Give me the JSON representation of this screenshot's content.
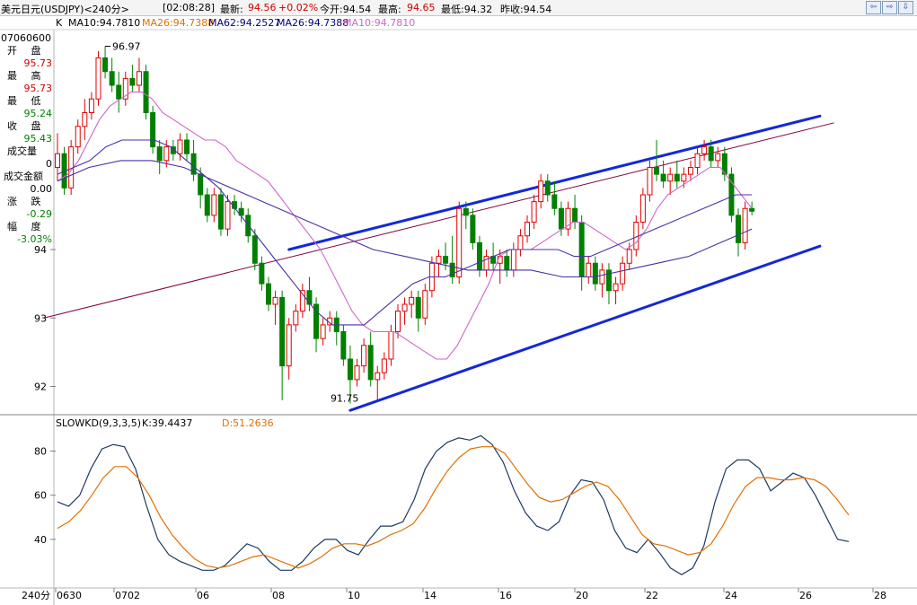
{
  "header": {
    "title": "美元日元(USDJPY)<240分>",
    "time": "[02:08:28]",
    "latest_label": "最新:",
    "latest_value": "94.56",
    "change": "+0.02%",
    "open": "今开:94.54",
    "high_label": "最高:",
    "high_value": "94.65",
    "low": "最低:94.32",
    "prev_close": "昨收:94.54",
    "nav": [
      "⇦",
      "⇨",
      "⇩"
    ]
  },
  "ma_legend": {
    "k": "K",
    "ma10": "MA10:94.7810",
    "ma26a": "MA26:94.7388",
    "ma62": "MA62:94.2527",
    "ma26b": "MA26:94.7388",
    "ma10b": "MA10:94.7810",
    "colors": {
      "ma10": "#000080",
      "ma26": "#e07000",
      "ma62": "#000080",
      "ma26b": "#000080",
      "ma10b": "#cc66cc"
    }
  },
  "info_panel": {
    "date": "07060600",
    "open_label": "开 盘",
    "open_value": "95.73",
    "high_label": "最 高",
    "high_value": "95.73",
    "low_label": "最 低",
    "low_value": "95.24",
    "close_label": "收 盘",
    "close_value": "95.43",
    "volume_label": "成交量",
    "volume_value": "0",
    "amount_label": "成交金额",
    "amount_value": "0.00",
    "change_label": "涨 跌",
    "change_value": "-0.29",
    "pct_label": "幅 度",
    "pct_value": "-3.03%"
  },
  "indicator_legend": {
    "name": "SLOWKD(9,3,3,5)",
    "k": "K:39.4437",
    "d": "D:51.2636"
  },
  "period_label": "240分",
  "chart_data": [
    {
      "type": "candlestick",
      "title": "美元日元(USDJPY)<240分>",
      "ylim": [
        91.6,
        97.2
      ],
      "yticks": [
        92,
        93,
        94
      ],
      "price_annotations": [
        {
          "text": "96.97",
          "value": 96.97
        },
        {
          "text": "91.75",
          "value": 91.75
        }
      ],
      "x_labels": [
        "0630",
        "0702",
        "06",
        "08",
        "10",
        "14",
        "16",
        "20",
        "22",
        "24",
        "26",
        "28"
      ],
      "candles": [
        [
          95.2,
          95.7,
          95.0,
          95.4
        ],
        [
          95.4,
          95.5,
          94.8,
          94.9
        ],
        [
          94.9,
          95.6,
          94.8,
          95.5
        ],
        [
          95.5,
          95.9,
          95.4,
          95.8
        ],
        [
          95.8,
          96.2,
          95.6,
          96.0
        ],
        [
          96.0,
          96.3,
          95.9,
          96.2
        ],
        [
          96.2,
          96.9,
          96.1,
          96.8
        ],
        [
          96.8,
          96.97,
          96.5,
          96.6
        ],
        [
          96.6,
          96.8,
          96.3,
          96.4
        ],
        [
          96.4,
          96.6,
          96.0,
          96.2
        ],
        [
          96.2,
          96.6,
          96.1,
          96.5
        ],
        [
          96.5,
          96.7,
          96.3,
          96.4
        ],
        [
          96.4,
          96.8,
          96.3,
          96.6
        ],
        [
          96.6,
          96.7,
          95.9,
          96.0
        ],
        [
          96.0,
          96.1,
          95.4,
          95.5
        ],
        [
          95.5,
          95.6,
          95.1,
          95.3
        ],
        [
          95.3,
          95.6,
          95.2,
          95.5
        ],
        [
          95.5,
          95.6,
          95.3,
          95.4
        ],
        [
          95.4,
          95.7,
          95.3,
          95.6
        ],
        [
          95.6,
          95.7,
          95.3,
          95.4
        ],
        [
          95.4,
          95.6,
          95.0,
          95.1
        ],
        [
          95.1,
          95.2,
          94.6,
          94.8
        ],
        [
          94.8,
          94.9,
          94.4,
          94.5
        ],
        [
          94.5,
          94.9,
          94.4,
          94.8
        ],
        [
          94.8,
          94.9,
          94.2,
          94.3
        ],
        [
          94.3,
          94.8,
          94.2,
          94.7
        ],
        [
          94.7,
          94.8,
          94.5,
          94.6
        ],
        [
          94.6,
          94.7,
          94.4,
          94.5
        ],
        [
          94.5,
          94.6,
          94.1,
          94.2
        ],
        [
          94.2,
          94.3,
          93.7,
          93.8
        ],
        [
          93.8,
          93.9,
          93.4,
          93.5
        ],
        [
          93.5,
          93.6,
          93.1,
          93.2
        ],
        [
          93.2,
          93.4,
          92.9,
          93.3
        ],
        [
          93.3,
          93.4,
          91.8,
          92.3
        ],
        [
          92.3,
          93.0,
          92.1,
          92.9
        ],
        [
          92.9,
          93.2,
          92.8,
          93.1
        ],
        [
          93.1,
          93.5,
          93.0,
          93.4
        ],
        [
          93.4,
          93.6,
          93.1,
          93.2
        ],
        [
          93.2,
          93.3,
          92.5,
          92.7
        ],
        [
          92.7,
          93.0,
          92.6,
          92.9
        ],
        [
          92.9,
          93.1,
          92.8,
          93.0
        ],
        [
          93.0,
          93.1,
          92.6,
          92.8
        ],
        [
          92.8,
          92.9,
          92.3,
          92.4
        ],
        [
          92.4,
          92.6,
          91.75,
          92.1
        ],
        [
          92.1,
          92.4,
          92.0,
          92.3
        ],
        [
          92.3,
          92.7,
          92.2,
          92.6
        ],
        [
          92.6,
          92.8,
          92.0,
          92.1
        ],
        [
          92.1,
          92.3,
          91.8,
          92.2
        ],
        [
          92.2,
          92.5,
          92.1,
          92.4
        ],
        [
          92.4,
          92.9,
          92.3,
          92.8
        ],
        [
          92.8,
          93.2,
          92.7,
          93.1
        ],
        [
          93.1,
          93.3,
          92.9,
          93.2
        ],
        [
          93.2,
          93.4,
          93.0,
          93.3
        ],
        [
          93.3,
          93.4,
          92.8,
          93.0
        ],
        [
          93.0,
          93.5,
          92.9,
          93.4
        ],
        [
          93.4,
          93.9,
          93.3,
          93.8
        ],
        [
          93.8,
          94.0,
          93.6,
          93.9
        ],
        [
          93.9,
          94.1,
          93.7,
          93.8
        ],
        [
          93.8,
          94.2,
          93.5,
          93.6
        ],
        [
          93.6,
          94.7,
          93.5,
          94.6
        ],
        [
          94.6,
          94.7,
          94.3,
          94.5
        ],
        [
          94.5,
          94.6,
          94.0,
          94.1
        ],
        [
          94.1,
          94.2,
          93.6,
          93.7
        ],
        [
          93.7,
          94.0,
          93.6,
          93.9
        ],
        [
          93.9,
          94.1,
          93.7,
          93.8
        ],
        [
          93.8,
          94.0,
          93.5,
          93.9
        ],
        [
          93.9,
          94.0,
          93.6,
          93.7
        ],
        [
          93.7,
          94.1,
          93.6,
          94.0
        ],
        [
          94.0,
          94.3,
          93.9,
          94.2
        ],
        [
          94.2,
          94.5,
          94.1,
          94.4
        ],
        [
          94.4,
          94.8,
          94.3,
          94.7
        ],
        [
          94.7,
          95.1,
          94.6,
          95.0
        ],
        [
          95.0,
          95.1,
          94.7,
          94.8
        ],
        [
          94.8,
          95.0,
          94.5,
          94.6
        ],
        [
          94.6,
          94.7,
          94.2,
          94.3
        ],
        [
          94.3,
          94.7,
          94.2,
          94.6
        ],
        [
          94.6,
          94.8,
          94.3,
          94.4
        ],
        [
          94.4,
          94.5,
          93.4,
          93.6
        ],
        [
          93.6,
          93.9,
          93.5,
          93.8
        ],
        [
          93.8,
          93.9,
          93.4,
          93.5
        ],
        [
          93.5,
          93.8,
          93.3,
          93.7
        ],
        [
          93.7,
          93.8,
          93.2,
          93.4
        ],
        [
          93.4,
          93.6,
          93.2,
          93.5
        ],
        [
          93.5,
          93.9,
          93.4,
          93.8
        ],
        [
          93.8,
          94.1,
          93.7,
          94.0
        ],
        [
          94.0,
          94.5,
          93.9,
          94.4
        ],
        [
          94.4,
          94.9,
          94.3,
          94.8
        ],
        [
          94.8,
          95.3,
          94.7,
          95.2
        ],
        [
          95.2,
          95.6,
          95.0,
          95.1
        ],
        [
          95.1,
          95.3,
          94.9,
          95.0
        ],
        [
          95.0,
          95.2,
          94.8,
          95.1
        ],
        [
          95.1,
          95.3,
          94.9,
          95.0
        ],
        [
          95.0,
          95.2,
          94.9,
          95.1
        ],
        [
          95.1,
          95.3,
          95.0,
          95.2
        ],
        [
          95.2,
          95.5,
          95.1,
          95.4
        ],
        [
          95.4,
          95.6,
          95.3,
          95.5
        ],
        [
          95.5,
          95.6,
          95.2,
          95.3
        ],
        [
          95.3,
          95.5,
          95.2,
          95.4
        ],
        [
          95.4,
          95.5,
          95.0,
          95.1
        ],
        [
          95.1,
          95.2,
          94.4,
          94.5
        ],
        [
          94.5,
          94.6,
          93.9,
          94.1
        ],
        [
          94.1,
          94.7,
          94.0,
          94.6
        ],
        [
          94.6,
          94.7,
          94.5,
          94.56
        ]
      ],
      "lines": [
        {
          "name": "MA10",
          "color": "#cc66cc",
          "values": [
            95.0,
            95.1,
            95.3,
            95.6,
            95.9,
            96.1,
            96.2,
            96.3,
            96.3,
            96.2,
            96.0,
            95.9,
            95.8,
            95.7,
            95.6,
            95.6,
            95.5,
            95.3,
            95.2,
            95.1,
            95.0,
            94.8,
            94.6,
            94.4,
            94.2,
            94.0,
            93.7,
            93.4,
            93.1,
            92.9,
            92.8,
            92.8,
            92.8,
            92.7,
            92.6,
            92.5,
            92.4,
            92.4,
            92.6,
            92.9,
            93.2,
            93.5,
            93.9,
            94.0,
            94.0,
            94.0,
            94.1,
            94.2,
            94.3,
            94.4,
            94.4,
            94.3,
            94.2,
            94.1,
            94.0,
            94.1,
            94.3,
            94.6,
            94.8,
            94.9,
            95.0,
            95.1,
            95.2,
            95.2,
            95.0,
            94.8,
            94.6
          ]
        },
        {
          "name": "MA26",
          "color": "#4b2fa8",
          "values": [
            95.1,
            95.2,
            95.3,
            95.5,
            95.6,
            95.6,
            95.6,
            95.5,
            95.3,
            95.1,
            94.9,
            94.6,
            94.3,
            94.0,
            93.7,
            93.4,
            93.1,
            92.9,
            92.9,
            92.9,
            93.1,
            93.3,
            93.5,
            93.6,
            93.6,
            93.7,
            93.8,
            93.9,
            94.0,
            94.0,
            94.0,
            94.0,
            93.9,
            93.9,
            94.0,
            94.1,
            94.2,
            94.3,
            94.4,
            94.5,
            94.6,
            94.7,
            94.8,
            94.8
          ]
        },
        {
          "name": "MA62",
          "color": "#4b2fa8",
          "values": [
            95.0,
            95.2,
            95.3,
            95.3,
            95.2,
            95.0,
            94.8,
            94.6,
            94.4,
            94.2,
            94.0,
            93.9,
            93.8,
            93.7,
            93.7,
            93.7,
            93.6,
            93.6,
            93.7,
            93.8,
            93.9,
            94.1,
            94.3
          ]
        }
      ],
      "trendlines": [
        {
          "name": "channel-upper",
          "color": "#1428d8",
          "from": [
            34,
            94.0
          ],
          "to": [
            112,
            95.95
          ]
        },
        {
          "name": "channel-lower",
          "color": "#1428d8",
          "from": [
            43,
            91.65
          ],
          "to": [
            112,
            94.05
          ]
        },
        {
          "name": "long-trend",
          "color": "#800040",
          "from": [
            -2,
            93.0
          ],
          "to": [
            114,
            95.85
          ]
        }
      ]
    },
    {
      "type": "line",
      "title": "SLOWKD(9,3,3,5)",
      "ylim": [
        20,
        90
      ],
      "yticks": [
        40,
        60,
        80
      ],
      "series": [
        {
          "name": "K",
          "color": "#1e3a5f",
          "values": [
            57,
            55,
            60,
            72,
            81,
            83,
            82,
            72,
            55,
            40,
            33,
            30,
            28,
            26,
            26,
            28,
            33,
            38,
            36,
            30,
            26,
            26,
            30,
            36,
            40,
            40,
            35,
            33,
            40,
            46,
            46,
            48,
            58,
            72,
            80,
            84,
            86,
            85,
            87,
            83,
            75,
            62,
            52,
            46,
            44,
            48,
            60,
            67,
            66,
            58,
            44,
            36,
            34,
            40,
            34,
            27,
            24,
            27,
            37,
            57,
            72,
            76,
            76,
            72,
            62,
            66,
            70,
            68,
            60,
            50,
            40,
            39
          ]
        },
        {
          "name": "D",
          "color": "#e07000",
          "values": [
            45,
            48,
            53,
            60,
            68,
            73,
            73,
            68,
            60,
            50,
            42,
            36,
            31,
            28,
            27,
            28,
            30,
            32,
            33,
            31,
            29,
            27,
            29,
            32,
            36,
            38,
            38,
            37,
            39,
            42,
            44,
            47,
            54,
            63,
            71,
            77,
            81,
            82,
            82,
            79,
            72,
            65,
            59,
            57,
            58,
            61,
            64,
            66,
            64,
            58,
            50,
            42,
            38,
            37,
            35,
            33,
            34,
            38,
            46,
            56,
            64,
            68,
            68,
            67,
            67,
            68,
            67,
            64,
            58,
            51
          ]
        }
      ]
    }
  ]
}
